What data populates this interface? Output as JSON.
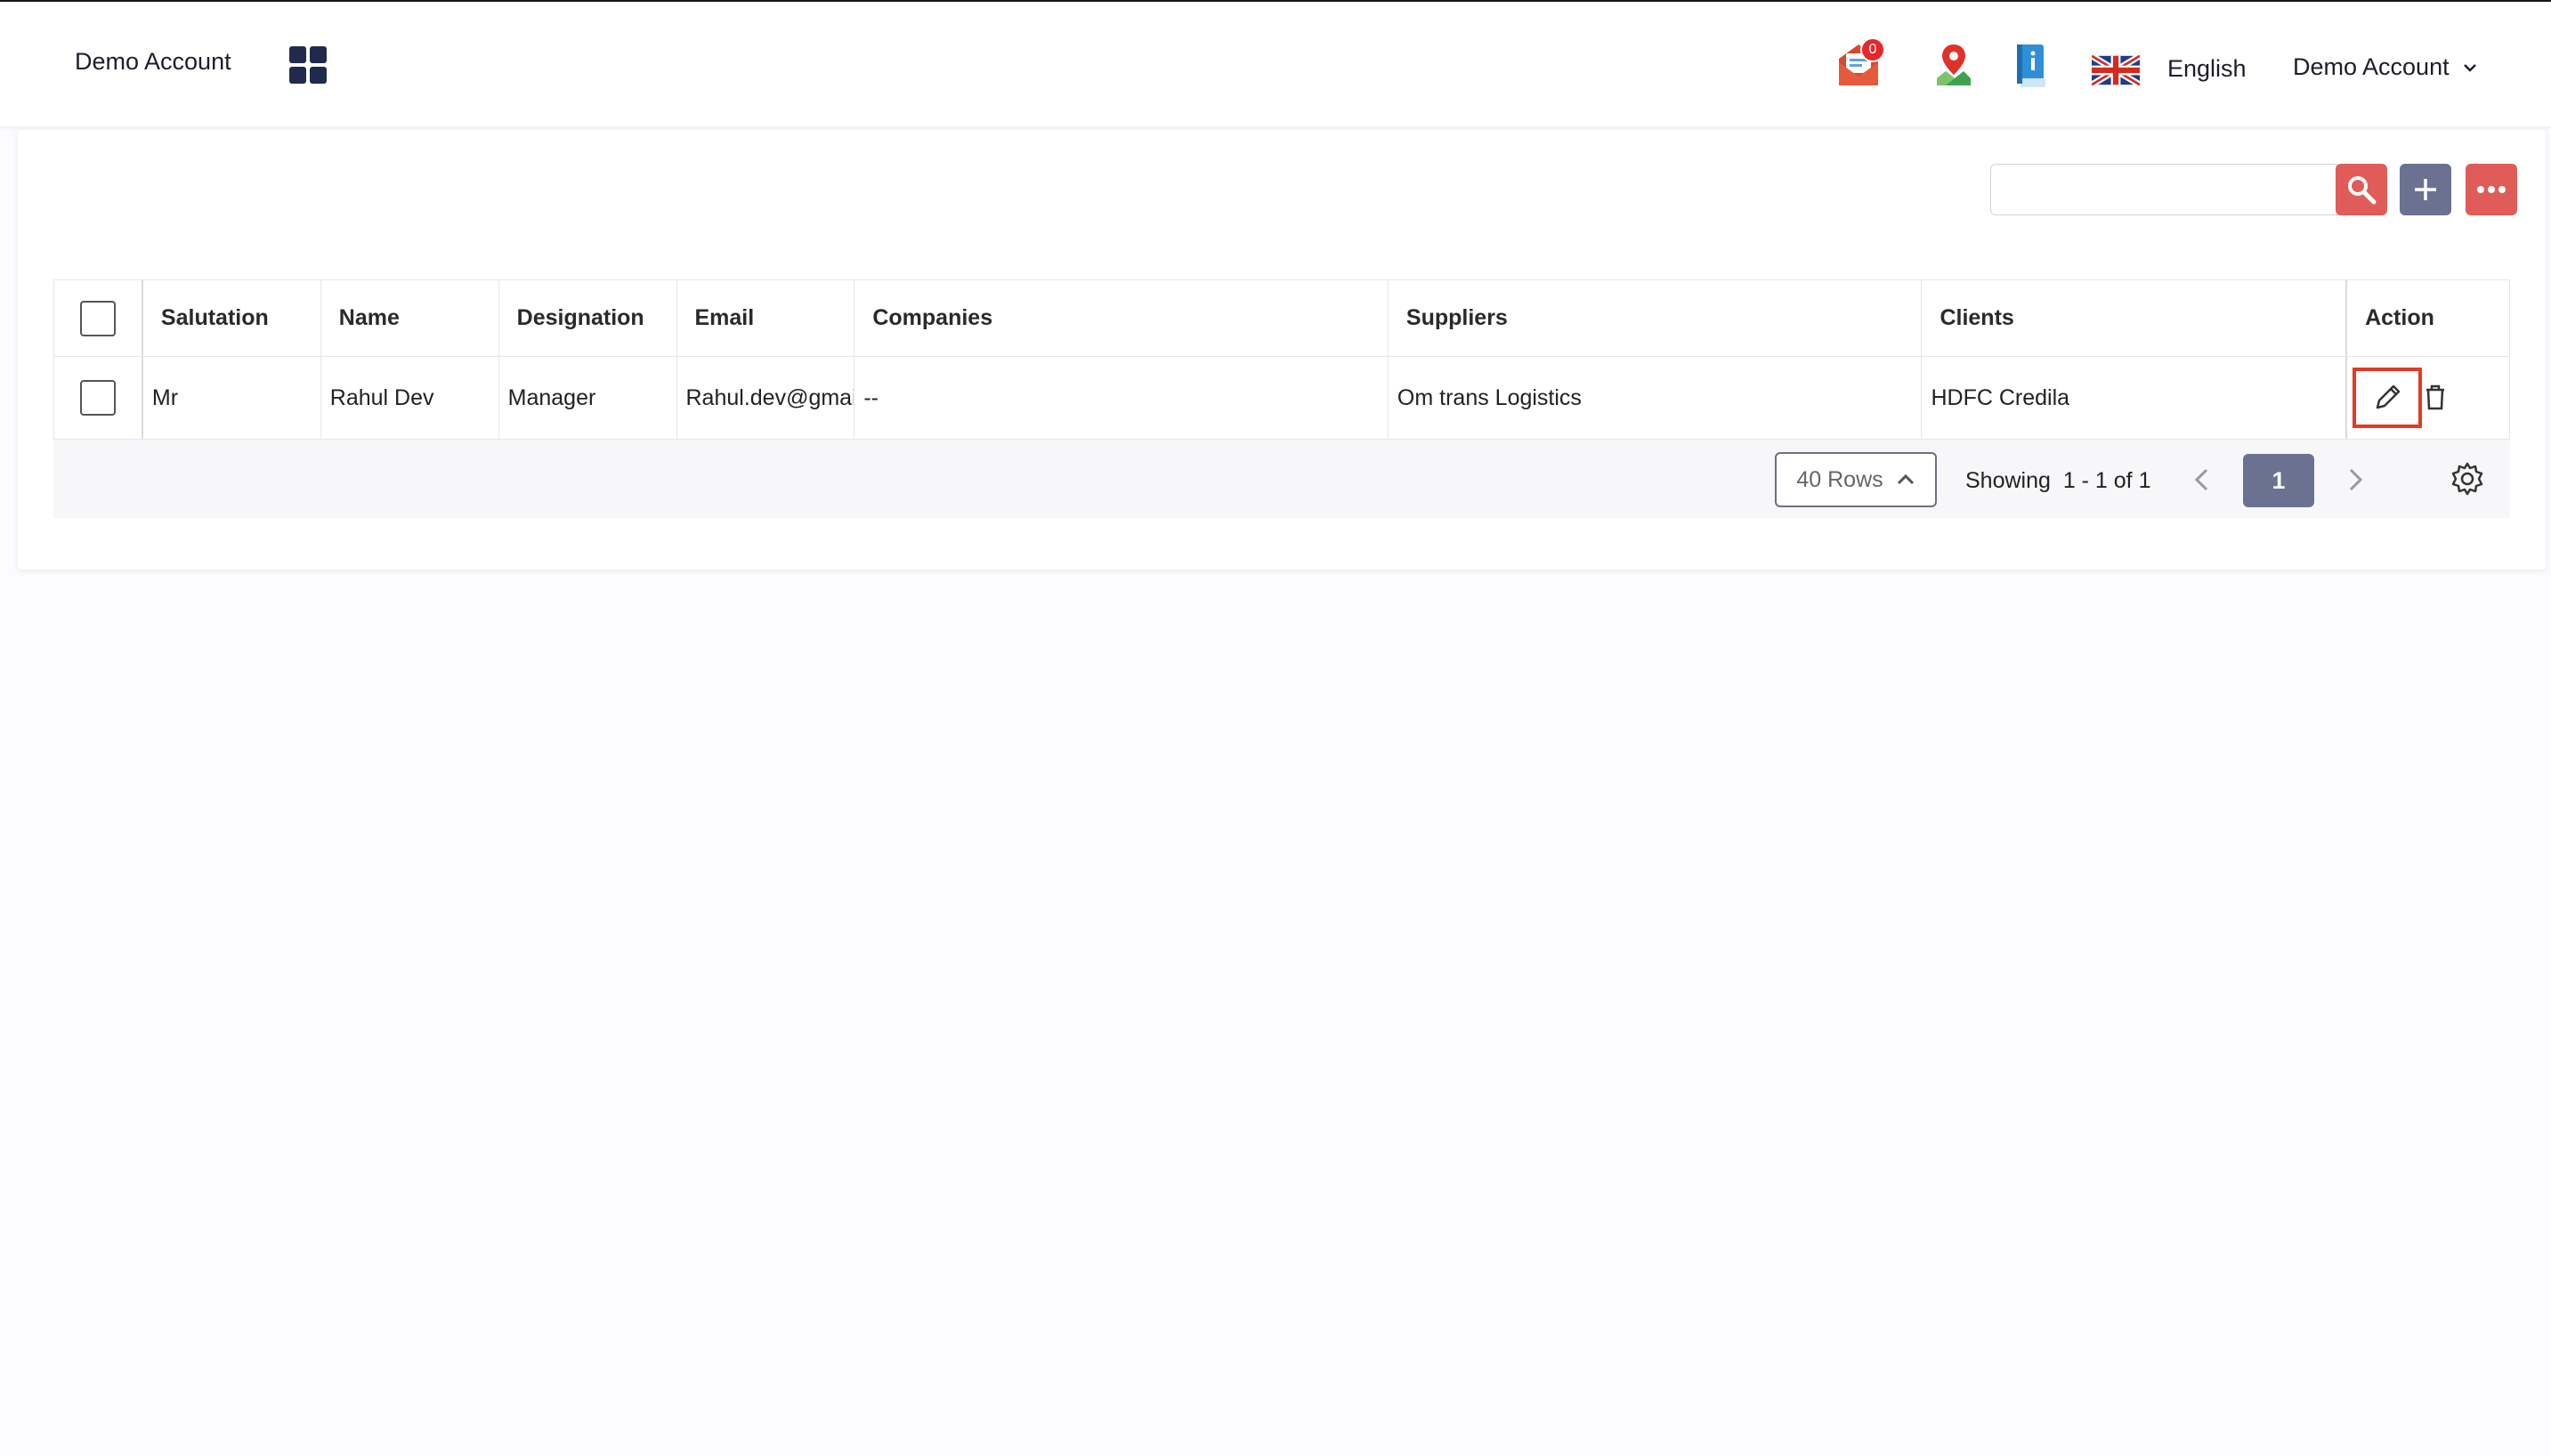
{
  "header": {
    "brand": "Demo Account",
    "mail_badge_count": "0",
    "language": "English",
    "account_name": "Demo Account"
  },
  "colors": {
    "accent_red": "#e05c59",
    "slate": "#6b7291",
    "navy": "#1f2a4d",
    "highlight": "#e23b22"
  },
  "search": {
    "placeholder": ""
  },
  "table": {
    "columns": [
      "Salutation",
      "Name",
      "Designation",
      "Email",
      "Companies",
      "Suppliers",
      "Clients",
      "Action"
    ],
    "rows": [
      {
        "salutation": "Mr",
        "name": "Rahul Dev",
        "designation": "Manager",
        "email": "Rahul.dev@gmail.com",
        "companies": "--",
        "suppliers": "Om trans Logistics",
        "clients": "HDFC Credila"
      }
    ]
  },
  "pagination": {
    "rows_label": "40 Rows",
    "showing_label": "Showing",
    "showing_range": "1 - 1 of 1",
    "current_page": "1"
  },
  "icons": {
    "apps": "grid-icon",
    "mail": "mail-icon",
    "map": "map-pin-icon",
    "info": "info-book-icon",
    "flag": "uk-flag-icon",
    "chevron": "chevron-down-icon",
    "search": "search-icon",
    "add": "plus-icon",
    "more": "more-icon",
    "edit": "pencil-icon",
    "delete": "trash-icon",
    "settings": "gear-icon"
  }
}
